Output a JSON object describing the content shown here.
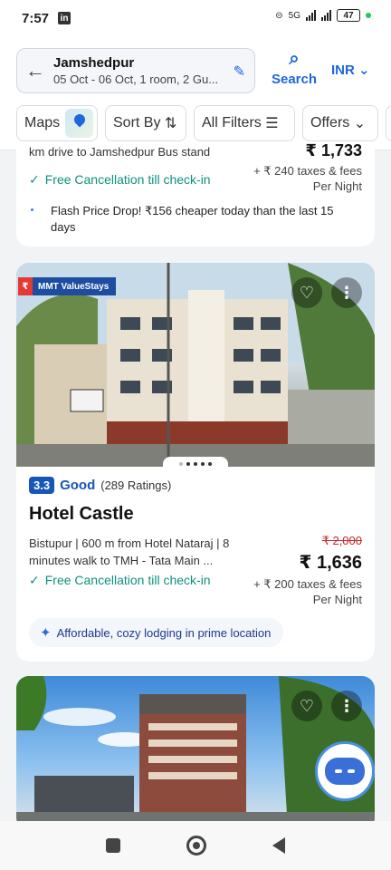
{
  "status": {
    "time": "7:57",
    "app_badge": "in",
    "network": "5G",
    "battery": "47"
  },
  "header": {
    "location": "Jamshedpur",
    "details": "05 Oct - 06 Oct, 1 room, 2 Gu...",
    "search_label": "Search",
    "currency": "INR"
  },
  "filters": {
    "maps": "Maps",
    "sort": "Sort By",
    "all_filters": "All Filters",
    "offers": "Offers"
  },
  "card1": {
    "partial_desc": "km drive to Jamshedpur Bus stand",
    "partial_price": "₹ 1,733",
    "free_cancel": "Free Cancellation till check-in",
    "taxes": "+ ₹ 240 taxes & fees",
    "per_night": "Per Night",
    "flash": "Flash Price Drop! ₹156 cheaper today than the last 15 days"
  },
  "card2": {
    "tag": "MMT ValueStays",
    "rating_score": "3.3",
    "rating_label": "Good",
    "rating_count": "(289 Ratings)",
    "name": "Hotel Castle",
    "location": "Bistupur | 600 m from Hotel Nataraj | 8 minutes walk to TMH - Tata Main ...",
    "old_price": "₹ 2,000",
    "price": "₹ 1,636",
    "free_cancel": "Free Cancellation till check-in",
    "taxes": "+ ₹ 200 taxes & fees",
    "per_night": "Per Night",
    "highlight": "Affordable, cozy lodging in prime location"
  }
}
